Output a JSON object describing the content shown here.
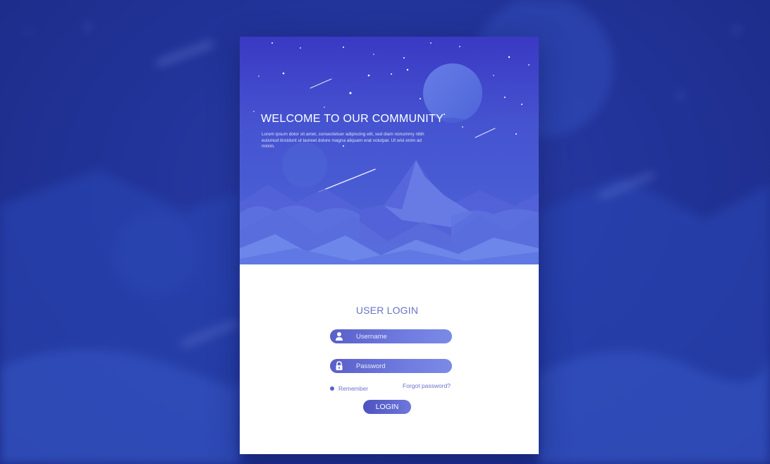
{
  "hero": {
    "title": "WELCOME TO OUR COMMUNITY",
    "description": "Lorem ipsum dolor sit amet, consectetuer adipiscing elit, sed diam nonummy nibh euismod tincidunt ut laoreet dolore magna aliquam erat volutpat. Ut wisi enim ad minim."
  },
  "login": {
    "title": "USER LOGIN",
    "username_placeholder": "Username",
    "password_placeholder": "Password",
    "remember_label": "Remember",
    "forgot_label": "Forgot password?",
    "button_label": "LOGIN"
  },
  "icons": {
    "username": "user-icon",
    "password": "lock-icon",
    "remember": "radio-dot-icon"
  },
  "colors": {
    "background": "#22349a",
    "hero_top": "#3b3fc6",
    "hero_bottom": "#5b7ae0",
    "accent": "#6a72c8",
    "field": "#6f7be0",
    "button": "#5a62c9"
  }
}
